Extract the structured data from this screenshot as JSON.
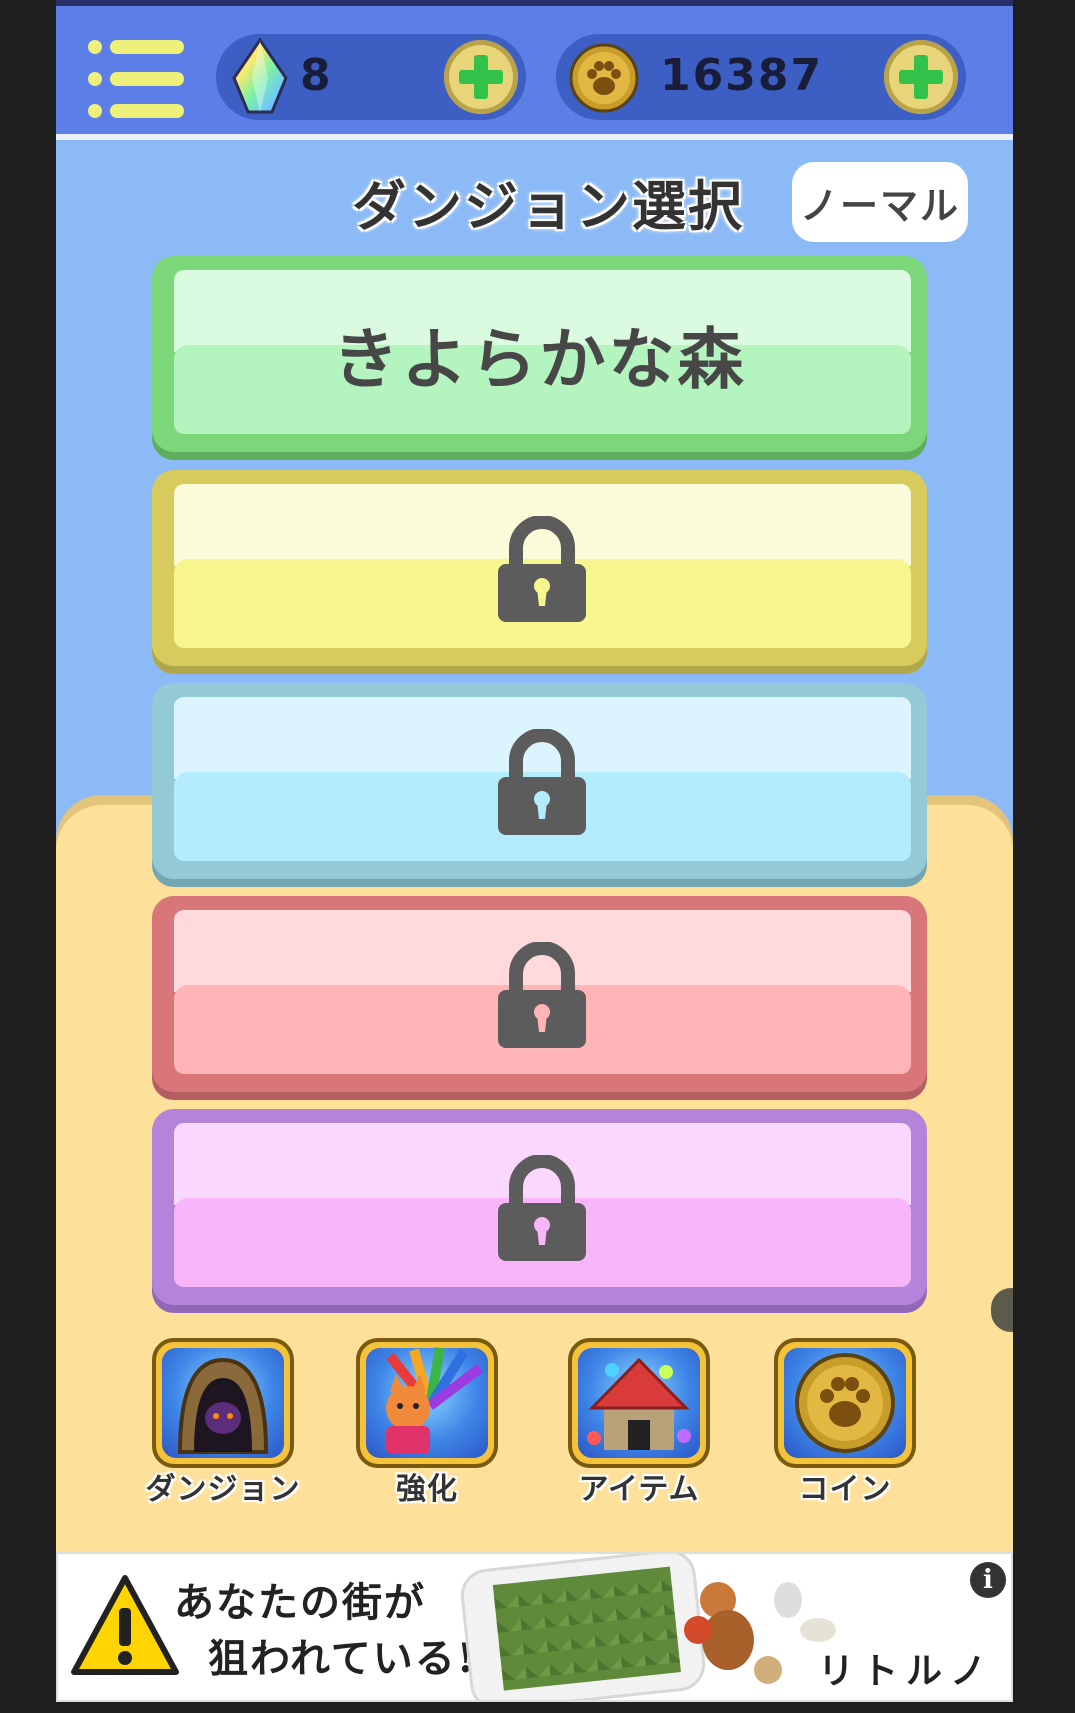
{
  "header": {
    "gems": "8",
    "coins": "16387",
    "menu_icon": "hamburger-menu-icon",
    "gem_icon": "rainbow-crystal-icon",
    "coin_icon": "paw-coin-icon",
    "add_icon": "green-plus-icon"
  },
  "main": {
    "title": "ダンジョン選択",
    "mode_label": "ノーマル",
    "dungeons": [
      {
        "label": "きよらかな森",
        "locked": false,
        "color": "#7cd67a"
      },
      {
        "label": "",
        "locked": true,
        "color": "#d6cb5c"
      },
      {
        "label": "",
        "locked": true,
        "color": "#93cad5"
      },
      {
        "label": "",
        "locked": true,
        "color": "#d8767a"
      },
      {
        "label": "",
        "locked": true,
        "color": "#b384da"
      }
    ]
  },
  "bottom_nav": {
    "items": [
      {
        "label": "ダンジョン",
        "icon": "dungeon-cave-icon"
      },
      {
        "label": "強化",
        "icon": "fox-power-up-icon"
      },
      {
        "label": "アイテム",
        "icon": "house-item-icon"
      },
      {
        "label": "コイン",
        "icon": "paw-coin-icon"
      }
    ]
  },
  "ad": {
    "line1": "あなたの街が",
    "line2": "狙われている!",
    "brand": "リトルノア",
    "info": "i"
  },
  "colors": {
    "header_bg": "#5b7fe6",
    "sky": "#8bbaf6",
    "sand": "#fde09a",
    "plus_green": "#32c24a"
  }
}
